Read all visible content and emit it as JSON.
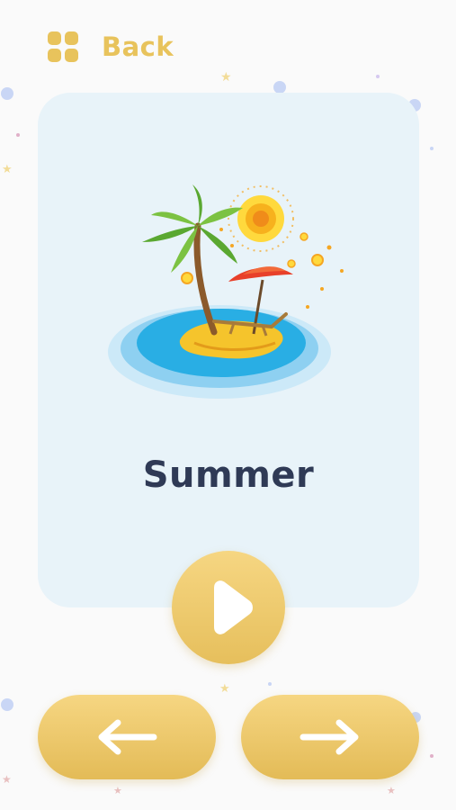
{
  "header": {
    "back_label": "Back",
    "menu_icon": "grid-icon"
  },
  "card": {
    "title": "Summer",
    "illustration": "summer-island-illustration"
  },
  "controls": {
    "play_icon": "play-icon",
    "prev_icon": "arrow-left-icon",
    "next_icon": "arrow-right-icon"
  },
  "colors": {
    "accent": "#e8c35c",
    "card_background": "#e8f3f9",
    "title": "#2f3a56",
    "background": "#fafafa"
  }
}
